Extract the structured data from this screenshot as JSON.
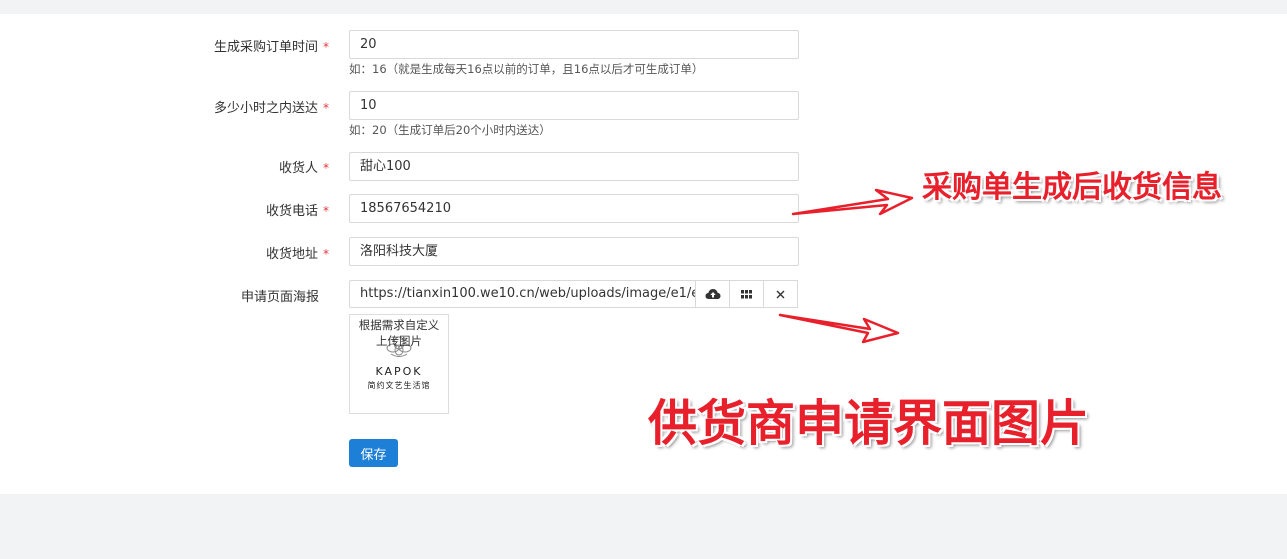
{
  "form": {
    "fields": [
      {
        "label": "生成采购订单时间",
        "value": "20",
        "help": "如：16（就是生成每天16点以前的订单，且16点以后才可生成订单）",
        "required": true
      },
      {
        "label": "多少小时之内送达",
        "value": "10",
        "help": "如：20（生成订单后20个小时内送达）",
        "required": true
      },
      {
        "label": "收货人",
        "value": "甜心100",
        "required": true
      },
      {
        "label": "收货电话",
        "value": "18567654210",
        "required": true
      },
      {
        "label": "收货地址",
        "value": "洛阳科技大厦",
        "required": true
      }
    ],
    "required_mark": "*",
    "poster": {
      "label": "申请页面海报",
      "url": "https://tianxin100.we10.cn/web/uploads/image/e1/e1",
      "buttons": [
        {
          "icon": "cloud-upload-icon"
        },
        {
          "icon": "grid-icon"
        },
        {
          "icon": "close-icon"
        }
      ],
      "thumbnail": {
        "line1": "根据需求自定义",
        "line2": "上传图片",
        "brand": "KAPOK",
        "subtitle": "简约文艺生活馆"
      }
    },
    "save_label": "保存"
  },
  "annotations": {
    "receiving_info": "采购单生成后收货信息",
    "supplier_image": "供货商申请界面图片"
  },
  "colors": {
    "primary": "#1e7fd6",
    "required": "#e4393c",
    "annotation": "#e8202b",
    "page_bg": "#f2f3f5"
  }
}
